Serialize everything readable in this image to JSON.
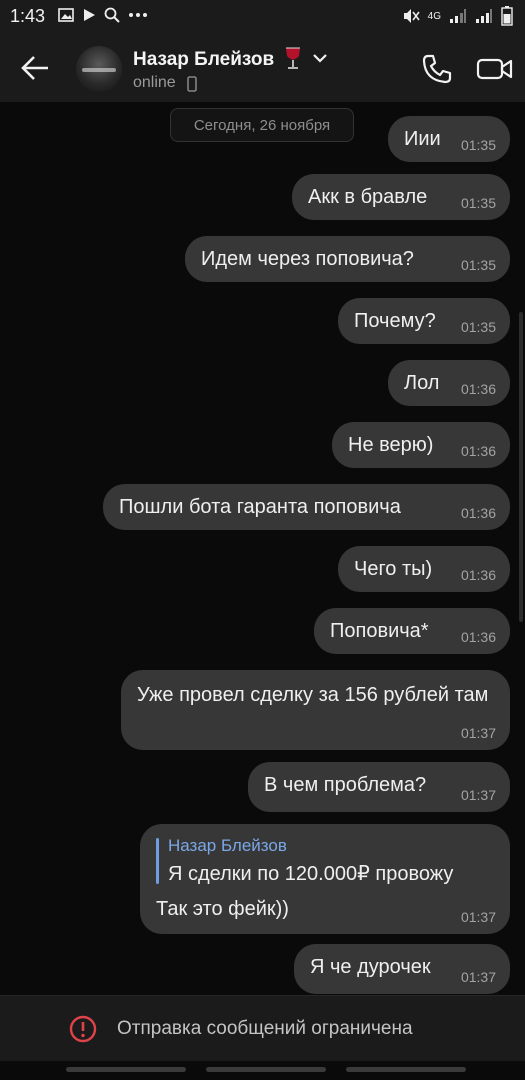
{
  "status_bar": {
    "time": "1:43",
    "left_icons": [
      "image-icon",
      "play-icon",
      "search-icon",
      "more-icon"
    ],
    "network": "4G",
    "right_icons": [
      "mute-icon",
      "signal-icon",
      "signal-icon",
      "battery-icon"
    ]
  },
  "header": {
    "contact_name": "Назар Блейзов",
    "name_emoji": "wine-glass-icon",
    "status": "online",
    "actions": [
      "phone-icon",
      "video-icon"
    ]
  },
  "chat": {
    "date_separator": "Сегодня, 26 ноября",
    "messages": [
      {
        "text": "Иии",
        "time": "01:35"
      },
      {
        "text": "Акк в бравле",
        "time": "01:35"
      },
      {
        "text": "Идем через поповича?",
        "time": "01:35"
      },
      {
        "text": "Почему?",
        "time": "01:35"
      },
      {
        "text": "Лол",
        "time": "01:36"
      },
      {
        "text": "Не верю)",
        "time": "01:36"
      },
      {
        "text": "Пошли бота гаранта поповича",
        "time": "01:36"
      },
      {
        "text": "Чего ты)",
        "time": "01:36"
      },
      {
        "text": "Поповича*",
        "time": "01:36"
      },
      {
        "text": "Уже провел сделку за 156 рублей там",
        "time": "01:37"
      },
      {
        "text": "В чем проблема?",
        "time": "01:37"
      },
      {
        "reply_name": "Назар Блейзов",
        "reply_text": "Я сделки по 120.000₽ провожу",
        "text": "Так это фейк))",
        "time": "01:37"
      },
      {
        "text": "Я че дурочек",
        "time": "01:37"
      }
    ]
  },
  "footer": {
    "restriction_text": "Отправка сообщений ограничена",
    "icon": "warning-icon",
    "accent_color": "#e0424a"
  },
  "colors": {
    "background": "#0a0a0a",
    "bubble": "#373737",
    "reply_accent": "#7aa7e8"
  }
}
